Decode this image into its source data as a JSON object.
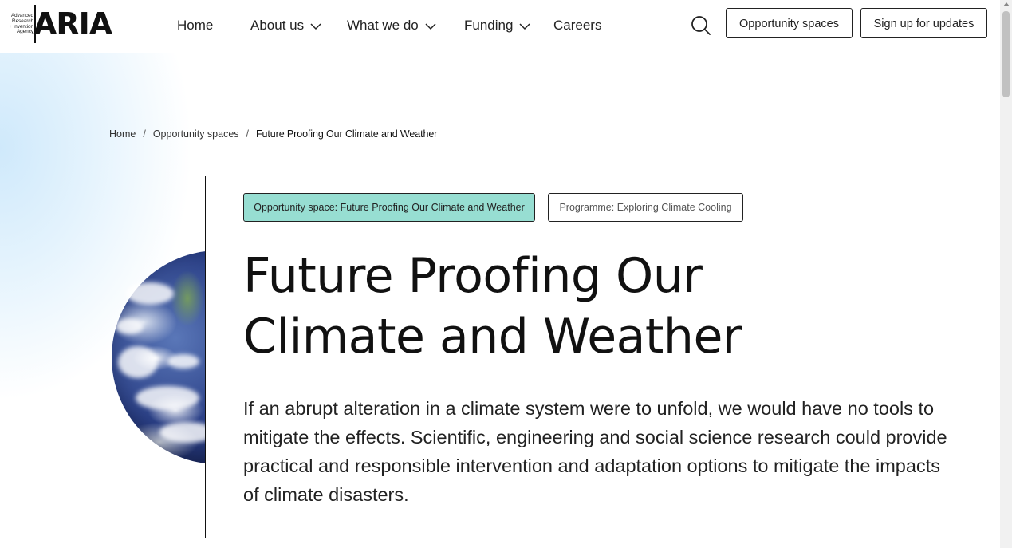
{
  "logo": {
    "small_text": [
      "Advanced",
      "Research",
      "+ Invention",
      "Agency"
    ],
    "wordmark": "ARIA"
  },
  "nav": {
    "items": [
      {
        "label": "Home",
        "has_dropdown": false
      },
      {
        "label": "About us",
        "has_dropdown": true
      },
      {
        "label": "What we do",
        "has_dropdown": true
      },
      {
        "label": "Funding",
        "has_dropdown": true
      },
      {
        "label": "Careers",
        "has_dropdown": false
      }
    ],
    "search_icon": "search-icon",
    "buttons": {
      "opportunity_spaces": "Opportunity spaces",
      "sign_up": "Sign up for updates"
    }
  },
  "breadcrumb": {
    "items": [
      "Home",
      "Opportunity spaces",
      "Future Proofing Our Climate and Weather"
    ],
    "separator": "/"
  },
  "tags": {
    "opportunity_space": "Opportunity space: Future Proofing Our Climate and Weather",
    "programme": "Programme: Exploring Climate Cooling"
  },
  "hero": {
    "title_line1": "Future Proofing Our",
    "title_line2": "Climate and Weather",
    "intro": "If an abrupt alteration in a climate system were to unfold, we would have no tools to mitigate the effects. Scientific, engineering and social science research could provide practical and responsible intervention and adaptation options to mitigate the impacts of climate disasters."
  },
  "colors": {
    "tag_highlight": "#97ded2",
    "glow": "#cfe9fb",
    "text": "#111111"
  }
}
